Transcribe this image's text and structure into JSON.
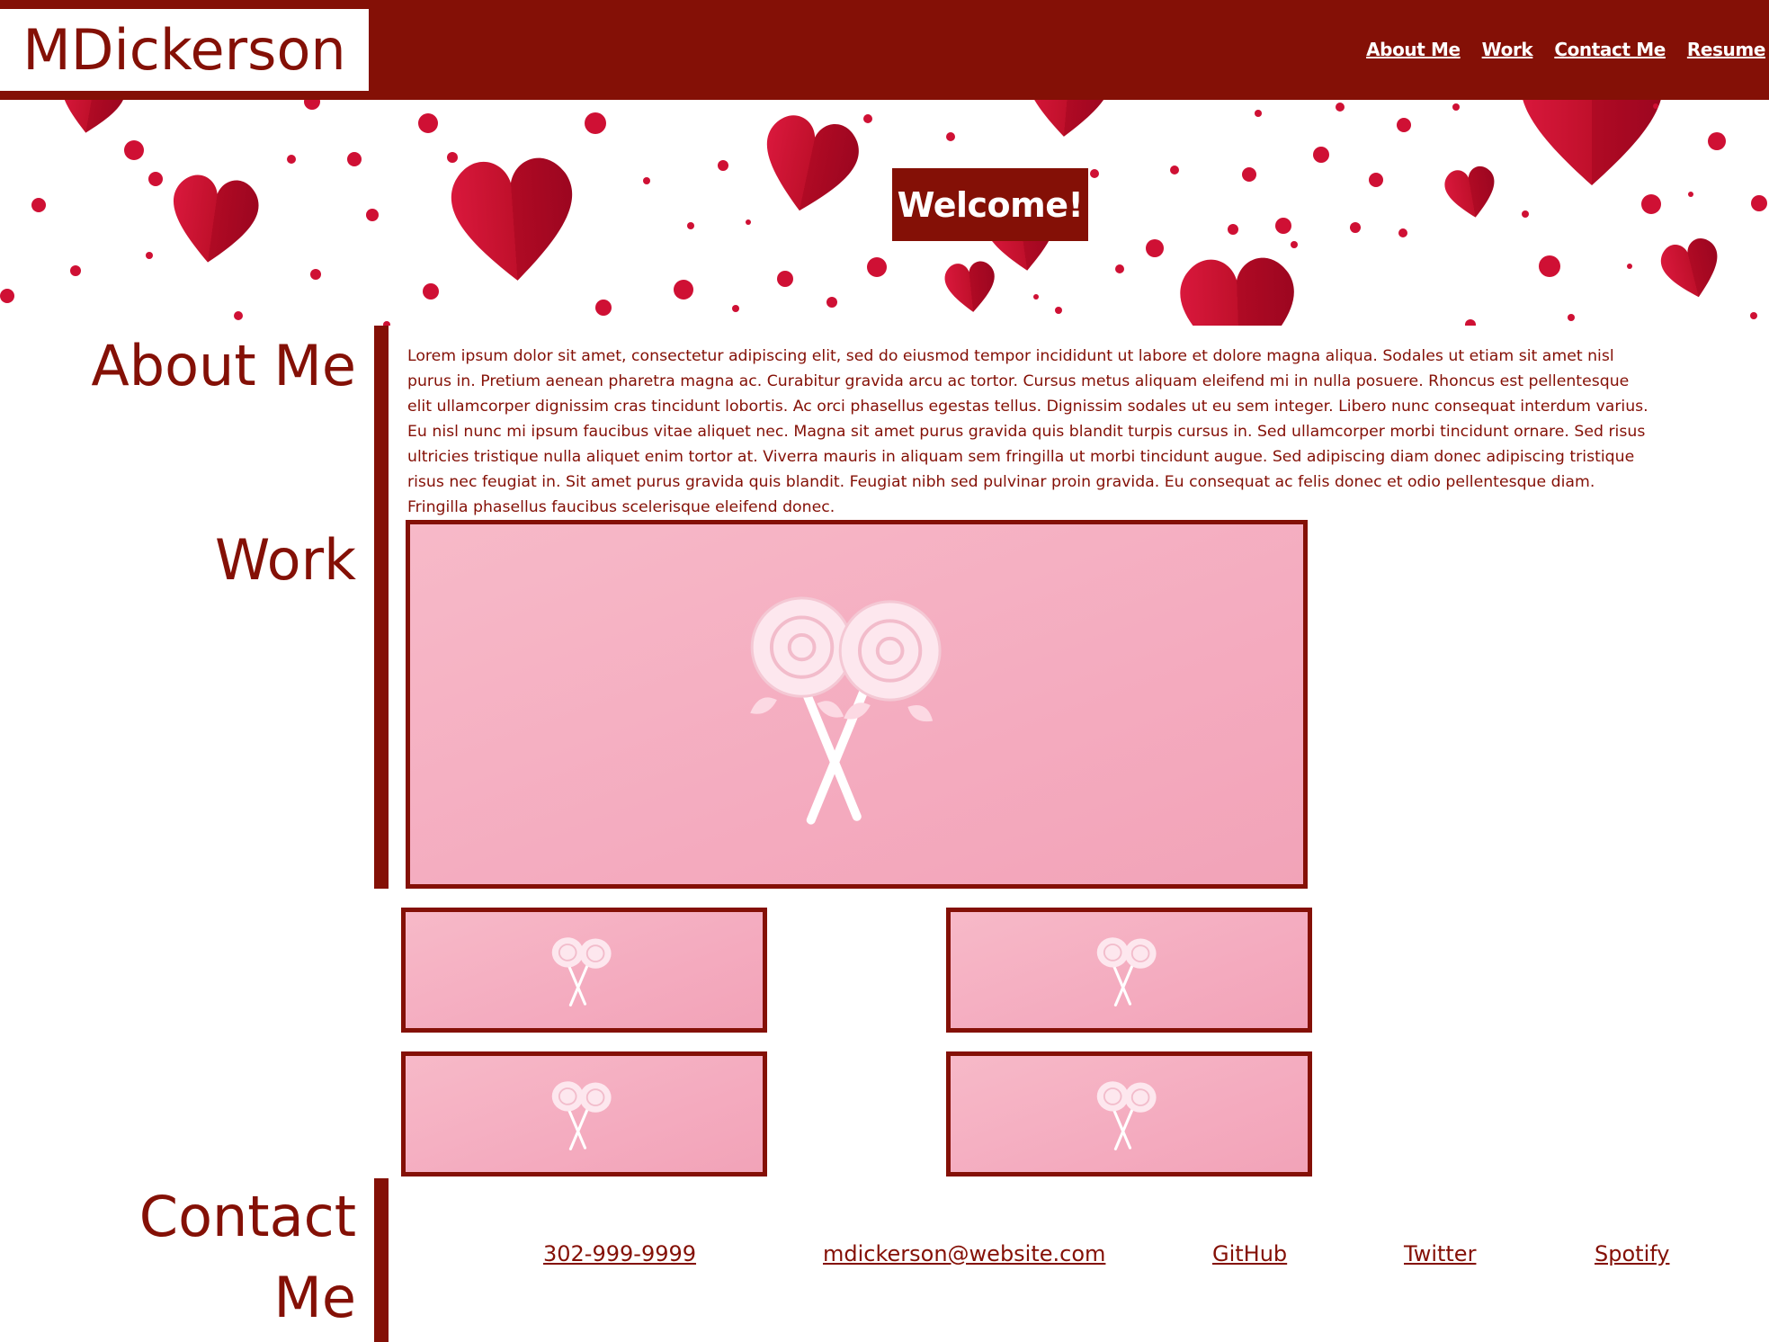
{
  "header": {
    "brand": "MDickerson",
    "nav": [
      "About Me",
      "Work",
      "Contact Me",
      "Resume"
    ]
  },
  "hero": {
    "welcome": "Welcome!",
    "background_icon": "hearts-pattern-icon"
  },
  "about": {
    "title": "About Me",
    "text": "Lorem ipsum dolor sit amet, consectetur adipiscing elit, sed do eiusmod tempor incididunt ut labore et dolore magna aliqua. Sodales ut etiam sit amet nisl purus in. Pretium aenean pharetra magna ac. Curabitur gravida arcu ac tortor. Cursus metus aliquam eleifend mi in nulla posuere. Rhoncus est pellentesque elit ullamcorper dignissim cras tincidunt lobortis. Ac orci phasellus egestas tellus. Dignissim sodales ut eu sem integer. Libero nunc consequat interdum varius. Eu nisl nunc mi ipsum faucibus vitae aliquet nec. Magna sit amet purus gravida quis blandit turpis cursus in. Sed ullamcorper morbi tincidunt ornare. Sed risus ultricies tristique nulla aliquet enim tortor at. Viverra mauris in aliquam sem fringilla ut morbi tincidunt augue. Sed adipiscing diam donec adipiscing tristique risus nec feugiat in. Sit amet purus gravida quis blandit. Feugiat nibh sed pulvinar proin gravida. Eu consequat ac felis donec et odio pellentesque diam. Fringilla phasellus faucibus scelerisque eleifend donec."
  },
  "work": {
    "title": "Work",
    "image_icon": "lollipops-photo-icon",
    "item_count": 5
  },
  "contact": {
    "title_line1": "Contact",
    "title_line2": "Me",
    "links": [
      "302-999-9999",
      "mdickerson@website.com",
      "GitHub",
      "Twitter",
      "Spotify"
    ]
  },
  "colors": {
    "accent": "#841006",
    "photo_bg": "#f5afc2",
    "heart": "#c8102e"
  }
}
